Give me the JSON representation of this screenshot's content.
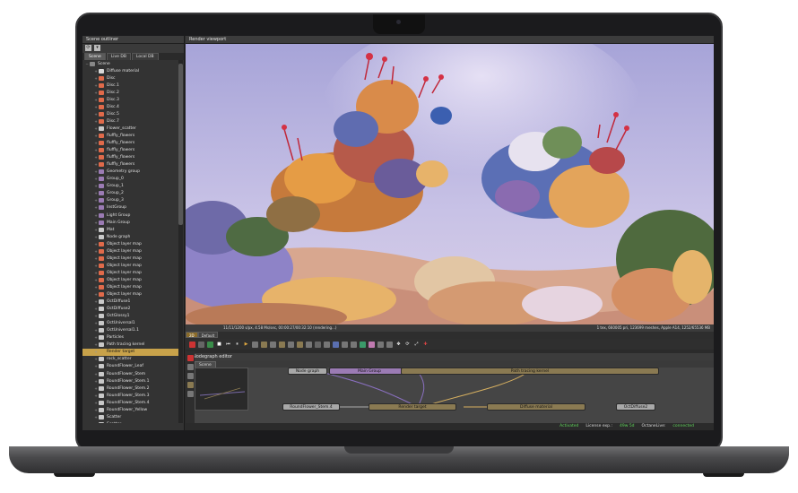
{
  "outliner": {
    "title": "Scene outliner",
    "tabs": [
      "Scene",
      "Live DB",
      "Local DB"
    ],
    "items": [
      {
        "label": "Scene",
        "expand": "−",
        "color": "#888888"
      },
      {
        "label": "Diffuse material",
        "expand": "+",
        "color": "#d9d9d9"
      },
      {
        "label": "Disc",
        "expand": "+",
        "color": "#e06a4a"
      },
      {
        "label": "Disc.1",
        "expand": "+",
        "color": "#e06a4a"
      },
      {
        "label": "Disc.2",
        "expand": "+",
        "color": "#e06a4a"
      },
      {
        "label": "Disc.3",
        "expand": "+",
        "color": "#e06a4a"
      },
      {
        "label": "Disc.4",
        "expand": "+",
        "color": "#e06a4a"
      },
      {
        "label": "Disc.5",
        "expand": "+",
        "color": "#e06a4a"
      },
      {
        "label": "Disc.7",
        "expand": "+",
        "color": "#e06a4a"
      },
      {
        "label": "Flower_scatter",
        "expand": "+",
        "color": "#c9c9c9"
      },
      {
        "label": "fluffly_flowers",
        "expand": "+",
        "color": "#e06a4a"
      },
      {
        "label": "fluffly_flowers",
        "expand": "+",
        "color": "#e06a4a"
      },
      {
        "label": "fluffly_flowers",
        "expand": "+",
        "color": "#e06a4a"
      },
      {
        "label": "fluffly_flowers",
        "expand": "+",
        "color": "#e06a4a"
      },
      {
        "label": "fluffly_flowers",
        "expand": "+",
        "color": "#e06a4a"
      },
      {
        "label": "Geometry group",
        "expand": "+",
        "color": "#9b7bb4"
      },
      {
        "label": "Group_0",
        "expand": "+",
        "color": "#9b7bb4"
      },
      {
        "label": "Group_1",
        "expand": "+",
        "color": "#9b7bb4"
      },
      {
        "label": "Group_2",
        "expand": "+",
        "color": "#9b7bb4"
      },
      {
        "label": "Group_3",
        "expand": "+",
        "color": "#9b7bb4"
      },
      {
        "label": "InstGroup",
        "expand": "+",
        "color": "#9b7bb4"
      },
      {
        "label": "Light Group",
        "expand": "+",
        "color": "#9b7bb4"
      },
      {
        "label": "Main Group",
        "expand": "+",
        "color": "#9b7bb4"
      },
      {
        "label": "Mat",
        "expand": "+",
        "color": "#c9c9c9"
      },
      {
        "label": "Node graph",
        "expand": "+",
        "color": "#c9c9c9"
      },
      {
        "label": "Object layer map",
        "expand": "+",
        "color": "#e06a4a"
      },
      {
        "label": "Object layer map",
        "expand": "+",
        "color": "#e06a4a"
      },
      {
        "label": "Object layer map",
        "expand": "+",
        "color": "#e06a4a"
      },
      {
        "label": "Object layer map",
        "expand": "+",
        "color": "#e06a4a"
      },
      {
        "label": "Object layer map",
        "expand": "+",
        "color": "#e06a4a"
      },
      {
        "label": "Object layer map",
        "expand": "+",
        "color": "#e06a4a"
      },
      {
        "label": "Object layer map",
        "expand": "+",
        "color": "#e06a4a"
      },
      {
        "label": "Object layer map",
        "expand": "+",
        "color": "#e06a4a"
      },
      {
        "label": "OctDiffuse1",
        "expand": "+",
        "color": "#c9c9c9"
      },
      {
        "label": "OctDiffuse2",
        "expand": "+",
        "color": "#c9c9c9"
      },
      {
        "label": "OctGlossy1",
        "expand": "+",
        "color": "#c9c9c9"
      },
      {
        "label": "OctUniversal1",
        "expand": "+",
        "color": "#c9c9c9"
      },
      {
        "label": "OctUniversal1.1",
        "expand": "+",
        "color": "#c9c9c9"
      },
      {
        "label": "Particles",
        "expand": "+",
        "color": "#c9c9c9"
      },
      {
        "label": "Path tracing kernel",
        "expand": "+",
        "color": "#c9c9c9"
      },
      {
        "label": "Render target",
        "expand": "+",
        "color": "#c8a24a",
        "selected": true
      },
      {
        "label": "rock_scatter",
        "expand": "+",
        "color": "#c9c9c9"
      },
      {
        "label": "RoundFlower_Leaf",
        "expand": "+",
        "color": "#c9c9c9"
      },
      {
        "label": "RoundFlower_Stem",
        "expand": "+",
        "color": "#c9c9c9"
      },
      {
        "label": "RoundFlower_Stem.1",
        "expand": "+",
        "color": "#c9c9c9"
      },
      {
        "label": "RoundFlower_Stem.2",
        "expand": "+",
        "color": "#c9c9c9"
      },
      {
        "label": "RoundFlower_Stem.3",
        "expand": "+",
        "color": "#c9c9c9"
      },
      {
        "label": "RoundFlower_Stem.4",
        "expand": "+",
        "color": "#c9c9c9"
      },
      {
        "label": "RoundFlower_Yellow",
        "expand": "+",
        "color": "#c9c9c9"
      },
      {
        "label": "Scatter",
        "expand": "+",
        "color": "#c9c9c9"
      },
      {
        "label": "Scatter",
        "expand": "+",
        "color": "#c9c9c9"
      }
    ]
  },
  "viewport": {
    "title": "Render viewport",
    "status_left": "11/11/1200 s/px, 4.58 Ms/sec, 00:00:27/00:32:10 (rendering...)",
    "status_right": "1 tex, 660005 pri, 123699 meshes, Apple A14, 1252/65536 MB",
    "tabs": [
      "2D",
      "Default"
    ]
  },
  "nodegraph": {
    "title": "Nodegraph editor",
    "tab": "Scene",
    "nodes": {
      "node_graph": "Node graph",
      "main_group": "Main Group",
      "path_tracing": "Path tracing kernel",
      "stem": "RoundFlower_Stem.4",
      "render_target": "Render target",
      "diffuse": "Diffuse material",
      "oct_diffuse": "OctDiffuse2"
    }
  },
  "status": {
    "activated": "Activated",
    "license_label": "License exp.:",
    "license_value": "49w 5d",
    "octanelive_label": "OctaneLive:",
    "octanelive_value": "connected"
  }
}
